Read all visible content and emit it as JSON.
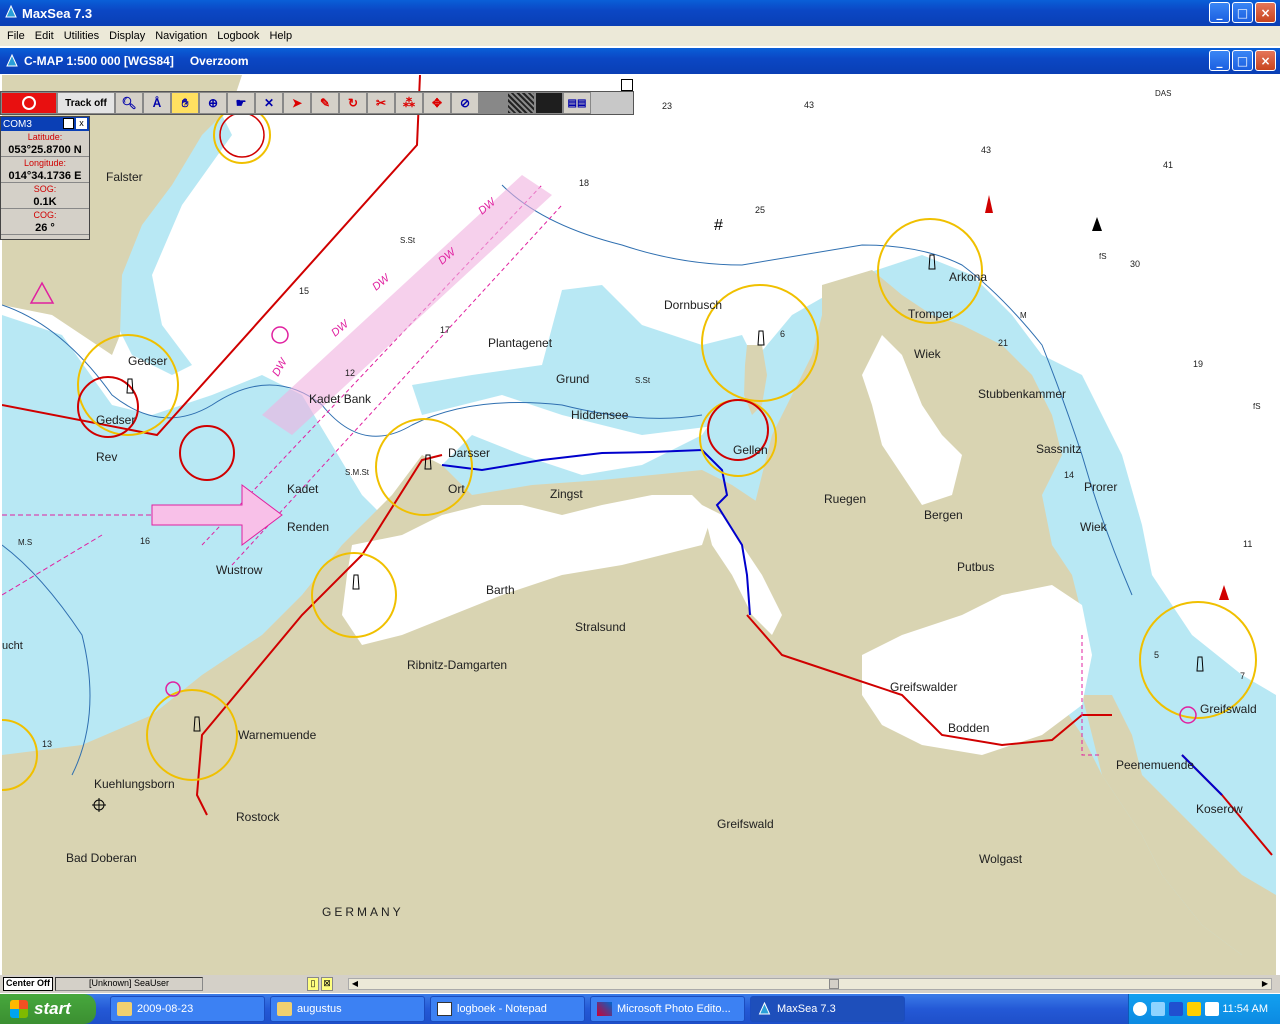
{
  "app": {
    "title": "MaxSea 7.3",
    "menu": [
      "File",
      "Edit",
      "Utilities",
      "Display",
      "Navigation",
      "Logbook",
      "Help"
    ]
  },
  "chart_window": {
    "title": "C-MAP  1:500 000 [WGS84]",
    "subtitle": "Overzoom"
  },
  "toolbar": {
    "track_label": "Track off"
  },
  "nav_panel": {
    "port": "COM3",
    "lat_label": "Latitude:",
    "lat_value": "053°25.8700 N",
    "lon_label": "Longitude:",
    "lon_value": "014°34.1736 E",
    "sog_label": "SOG:",
    "sog_value": "0.1K",
    "cog_label": "COG:",
    "cog_value": "26 °"
  },
  "map": {
    "place_names": [
      "Falster",
      "Gedser",
      "Gedser",
      "Rev",
      "Kadet Bank",
      "Kadet",
      "Renden",
      "Wustrow",
      "Darsser",
      "Ort",
      "Zingst",
      "Plantagenet",
      "Grund",
      "Hiddensee",
      "Dornbusch",
      "Gellen",
      "Ruegen",
      "Bergen",
      "Putbus",
      "Arkona",
      "Tromper",
      "Wiek",
      "Stubbenkammer",
      "Sassnitz",
      "Prorer",
      "Wiek",
      "Barth",
      "Stralsund",
      "Ribnitz-Damgarten",
      "Warnemuende",
      "Kuehlungsborn",
      "Rostock",
      "Bad Doberan",
      "Greifswalder",
      "Bodden",
      "Greifswald",
      "Peenemuende",
      "Wolgast",
      "Greifswald",
      "Koserow",
      "GERMANY",
      "M.S",
      "S.St",
      "S.M.St",
      "S.St",
      "M",
      "fS",
      "fS",
      "DAS",
      "ucht"
    ],
    "depths": [
      "23",
      "43",
      "43",
      "41",
      "18",
      "25",
      "15",
      "17",
      "12",
      "6",
      "7",
      "30",
      "19",
      "11",
      "14",
      "21",
      "13",
      "16",
      "5"
    ],
    "route_markers": [
      "DW",
      "DW",
      "DW",
      "DW",
      "DW"
    ]
  },
  "statusbar": {
    "center": "Center Off",
    "user": "[Unknown] SeaUser"
  },
  "taskbar": {
    "start": "start",
    "tasks": [
      "2009-08-23",
      "augustus",
      "logboek - Notepad",
      "Microsoft Photo Edito...",
      "MaxSea 7.3"
    ],
    "clock": "11:54 AM"
  },
  "colors": {
    "land": "#d9d4b2",
    "shallow": "#b8e8f4",
    "deep": "#ffffff",
    "border": "#d00000",
    "track": "#0000cc"
  }
}
